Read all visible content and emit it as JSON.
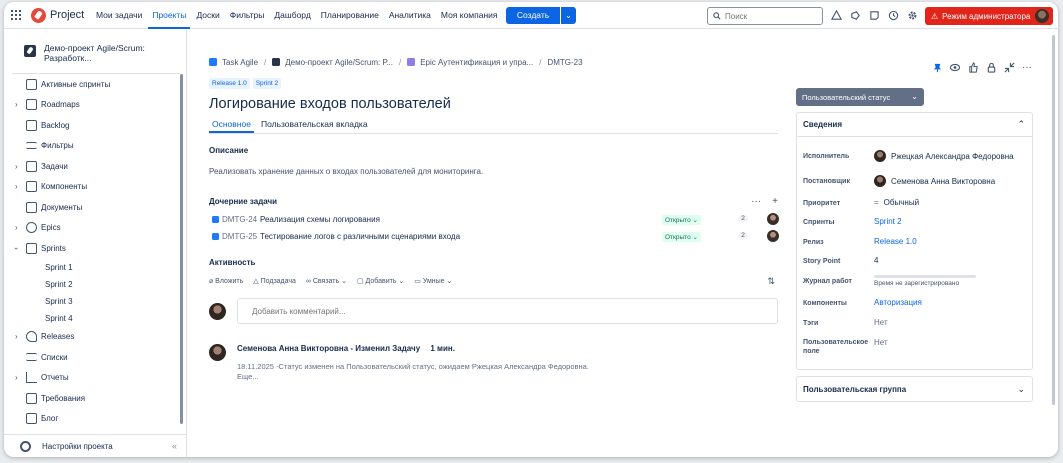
{
  "topbar": {
    "brand": "Project",
    "nav": [
      "Мои задачи",
      "Проекты",
      "Доски",
      "Фильтры",
      "Дашборд",
      "Планирование",
      "Аналитика",
      "Моя компания"
    ],
    "active_nav": "Проекты",
    "create_label": "Создать",
    "search_placeholder": "Поиск",
    "admin_label": "Режим администратора",
    "accent": "#0c66e4",
    "admin_color": "#e1251b"
  },
  "sidebar": {
    "project_name": "Демо-проект Agile/Scrum: Разработк...",
    "items": [
      {
        "label": "Активные спринты",
        "icon": "board-icon",
        "expandable": false
      },
      {
        "label": "Roadmaps",
        "icon": "roadmap-icon",
        "expandable": true
      },
      {
        "label": "Backlog",
        "icon": "backlog-icon",
        "expandable": false
      },
      {
        "label": "Фильтры",
        "icon": "filter-icon",
        "expandable": false
      },
      {
        "label": "Задачи",
        "icon": "tasks-icon",
        "expandable": true
      },
      {
        "label": "Компоненты",
        "icon": "components-icon",
        "expandable": true
      },
      {
        "label": "Документы",
        "icon": "document-icon",
        "expandable": false
      },
      {
        "label": "Epics",
        "icon": "epic-icon",
        "expandable": true
      },
      {
        "label": "Sprints",
        "icon": "sprint-icon",
        "expandable": true,
        "expanded": true
      }
    ],
    "sprints": [
      "Sprint 1",
      "Sprint 2",
      "Sprint 3",
      "Sprint 4"
    ],
    "items_after": [
      {
        "label": "Releases",
        "icon": "rocket-icon",
        "expandable": true
      },
      {
        "label": "Списки",
        "icon": "list-icon",
        "expandable": false
      },
      {
        "label": "Отчеты",
        "icon": "chart-icon",
        "expandable": true
      },
      {
        "label": "Требования",
        "icon": "requirements-icon",
        "expandable": false
      },
      {
        "label": "Блог",
        "icon": "blog-icon",
        "expandable": false
      }
    ],
    "footer": "Настройки проекта"
  },
  "breadcrumb": {
    "items": [
      "Task Agile",
      "Демо-проект Agile/Scrum: Р...",
      "Epic Аутентификация и упра...",
      "DMTG-23"
    ]
  },
  "issue": {
    "tags": [
      "Release 1.0",
      "Sprint 2"
    ],
    "title": "Логирование входов пользователей",
    "tabs": [
      "Основное",
      "Пользовательская вкладка"
    ],
    "description_heading": "Описание",
    "description": "Реализовать хранение данных о входах пользователей для мониторинга.",
    "children_heading": "Дочерние задачи",
    "children": [
      {
        "key": "DMTG-24",
        "summary": "Реализация схемы логирования",
        "status": "Открыто ⌄",
        "count": "2"
      },
      {
        "key": "DMTG-25",
        "summary": "Тестирование логов с различными сценариями входа",
        "status": "Открыто ⌄",
        "count": "2"
      }
    ],
    "activity_heading": "Активность",
    "activity_tools": [
      "Вложить",
      "Подзадача",
      "Связать ⌄",
      "Добавить ⌄",
      "Умные ⌄"
    ],
    "comment_placeholder": "Добавить комментарий...",
    "history": {
      "author": "Семенова Анна Викторовна",
      "action": "- Изменил Задачу",
      "time": "1 мин.",
      "text": "18.11.2025 -Статус изменен на Пользовательский статус, ожидаем Ржецкая Александра Федоровна.",
      "more": "Еще..."
    }
  },
  "panel": {
    "status_button": "Пользовательский статус",
    "details_heading": "Сведения",
    "fields": [
      {
        "label": "Исполнитель",
        "value": "Ржецкая Александра Федоровна"
      },
      {
        "label": "Постановщик",
        "value": "Семенова Анна Викторовна"
      },
      {
        "label": "Приоритет",
        "value": "Обычный"
      },
      {
        "label": "Спринты",
        "value": "Sprint 2"
      },
      {
        "label": "Релиз",
        "value": "Release 1.0"
      },
      {
        "label": "Story Point",
        "value": "4"
      },
      {
        "label": "Журнал работ",
        "value": "Время не зарегистрировано"
      },
      {
        "label": "Компоненты",
        "value": "Авторизация"
      },
      {
        "label": "Тэги",
        "value": "Нет"
      },
      {
        "label": "Пользовательское поле",
        "value": "Нет"
      }
    ],
    "group_heading": "Пользовательская группа"
  }
}
